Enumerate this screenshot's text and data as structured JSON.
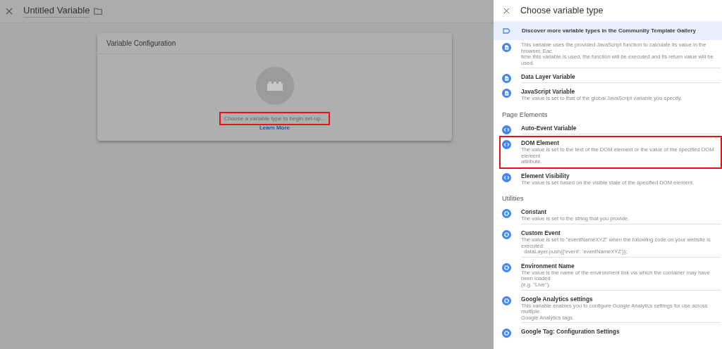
{
  "editor": {
    "title": "Untitled Variable"
  },
  "card": {
    "title": "Variable Configuration",
    "prompt": "Choose a variable type to begin set-up...",
    "highlighted": true,
    "link": "Learn More"
  },
  "panel": {
    "title": "Choose variable type",
    "banner": "Discover more variable types in the Community Template Gallery",
    "sections": [
      {
        "items": [
          {
            "kind": "document",
            "lines": [
              "This variable uses the provided JavaScript function to calculate its value in the browser. Eac",
              "time this variable is used, the function will be executed and its return value will be used."
            ],
            "highlighted": false
          },
          {
            "kind": "document",
            "name": "Data Layer Variable",
            "highlighted": false
          },
          {
            "kind": "document",
            "name": "JavaScript Variable",
            "lines": [
              "The value is set to that of the global JavaScript variable you specify."
            ],
            "highlighted": false
          }
        ]
      },
      {
        "heading": "Page Elements",
        "items": [
          {
            "kind": "code",
            "name": "Auto-Event Variable",
            "highlighted": false
          },
          {
            "kind": "code",
            "name": "DOM Element",
            "lines": [
              "The value is set to the text of the DOM element or the value of the specified DOM element",
              "attribute."
            ],
            "highlighted": true
          },
          {
            "kind": "code",
            "name": "Element Visibility",
            "lines": [
              "The value is set based on the visible state of the specified DOM element."
            ],
            "highlighted": false
          }
        ]
      },
      {
        "heading": "Utilities",
        "items": [
          {
            "kind": "gear",
            "name": "Constant",
            "lines": [
              "The value is set to the string that you provide."
            ],
            "highlighted": false
          },
          {
            "kind": "gear",
            "name": "Custom Event",
            "lines": [
              "The value is set to \"eventNameXYZ\" when the following code on your website is executed:",
              "  dataLayer.push({'event': 'eventNameXYZ'});"
            ],
            "highlighted": false
          },
          {
            "kind": "gear",
            "name": "Environment Name",
            "lines": [
              "The value is the name of the environment link via which the container may have been loaded",
              "(e.g. \"Live\")."
            ],
            "highlighted": false
          },
          {
            "kind": "gear",
            "name": "Google Analytics settings",
            "lines": [
              "This variable enables you to configure Google Analytics settings for use across multiple",
              "Google Analytics tags."
            ],
            "highlighted": false
          },
          {
            "kind": "gear",
            "name": "Google Tag: Configuration Settings",
            "highlighted": false
          }
        ]
      }
    ]
  }
}
